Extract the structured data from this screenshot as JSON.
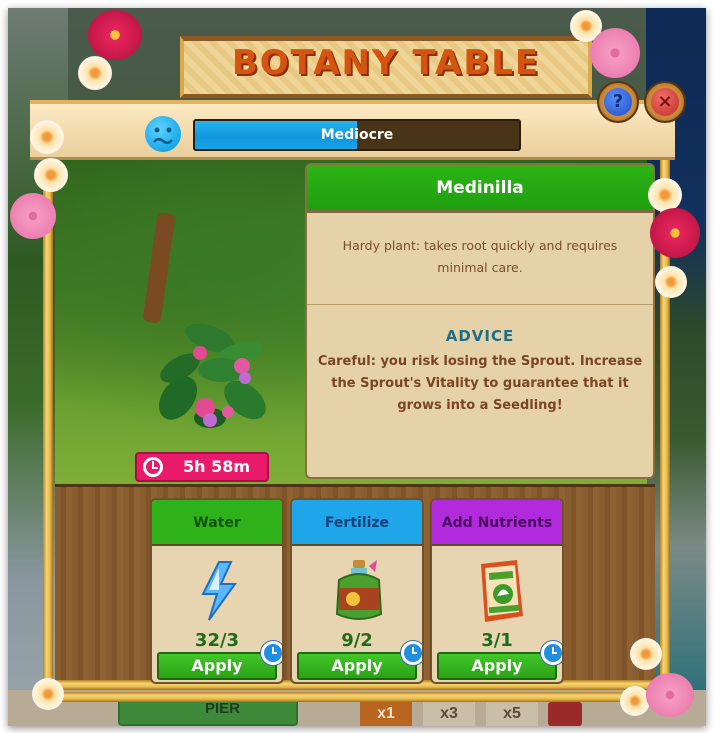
{
  "dialog": {
    "title": "BOTANY TABLE",
    "help_button": "?",
    "close_button": "×"
  },
  "status": {
    "mood_icon": "sad-face-icon",
    "vitality_label": "Mediocre",
    "vitality_fraction": 0.5,
    "colors": {
      "fill": "#1aa4e6",
      "track": "#4a3418"
    }
  },
  "plant": {
    "timer_icon": "clock-icon",
    "timer": "5h 58m"
  },
  "info": {
    "name": "Medinilla",
    "description": "Hardy plant: takes root quickly and requires minimal care.",
    "advice_title": "ADVICE",
    "advice_text": "Careful: you risk losing the Sprout. Increase the Sprout's Vitality to guarantee that it grows into a Seedling!"
  },
  "actions": [
    {
      "label": "Water",
      "icon": "lightning-bolt-icon",
      "count": "32/3",
      "button": "Apply",
      "color": "#2fb11a"
    },
    {
      "label": "Fertilize",
      "icon": "potion-bottle-icon",
      "count": "9/2",
      "button": "Apply",
      "color": "#1fa5ea"
    },
    {
      "label": "Add Nutrients",
      "icon": "seed-bag-icon",
      "count": "3/1",
      "button": "Apply",
      "color": "#b12adc"
    }
  ],
  "background": {
    "pier_label": "PIER",
    "multipliers": [
      "x1",
      "x3",
      "x5"
    ]
  }
}
